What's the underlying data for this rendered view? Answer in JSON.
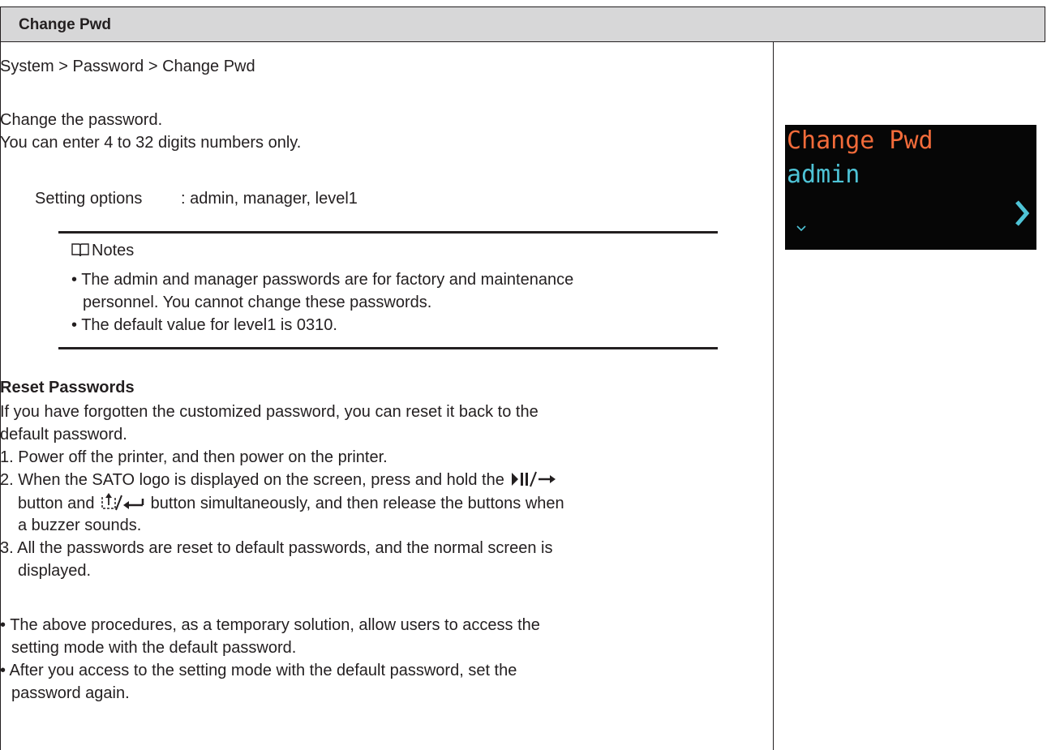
{
  "header": {
    "title": "Change Pwd"
  },
  "breadcrumb": "System > Password > Change Pwd",
  "intro": {
    "line1": "Change the password.",
    "line2": "You can enter 4 to 32 digits numbers only."
  },
  "setting": {
    "label": "Setting options",
    "value": ": admin, manager, level1"
  },
  "notes": {
    "heading": "Notes",
    "items": [
      "• The admin and manager passwords are for factory and maintenance",
      "personnel. You cannot change these passwords.",
      "• The default value for level1 is 0310."
    ]
  },
  "reset": {
    "heading": "Reset Passwords",
    "intro_line1": "If you have forgotten the customized password, you can reset it back to the",
    "intro_line2": "default password.",
    "step1": "1. Power off the printer, and then power on the printer.",
    "step2_line1": "2. When the SATO logo is displayed on the screen, press and hold the",
    "step2_line2a": "button and",
    "step2_line2b": "button simultaneously, and then release the buttons when",
    "step2_line3": "a buzzer sounds.",
    "step3_line1": "3. All the passwords are reset to default passwords, and the normal screen is",
    "step3_line2": "displayed."
  },
  "bullets": {
    "b1_line1": "• The above procedures, as a temporary solution, allow users to access the",
    "b1_line2": "setting mode with the default password.",
    "b2_line1": "• After you access to the setting mode with the default password, set the",
    "b2_line2": "password again."
  },
  "device_screen": {
    "title": "Change Pwd",
    "value": "admin",
    "title_color": "#f26b3a",
    "value_color": "#4ec3d6",
    "right_icon": "chevron-right-icon",
    "down_icon": "chevron-down-icon"
  }
}
